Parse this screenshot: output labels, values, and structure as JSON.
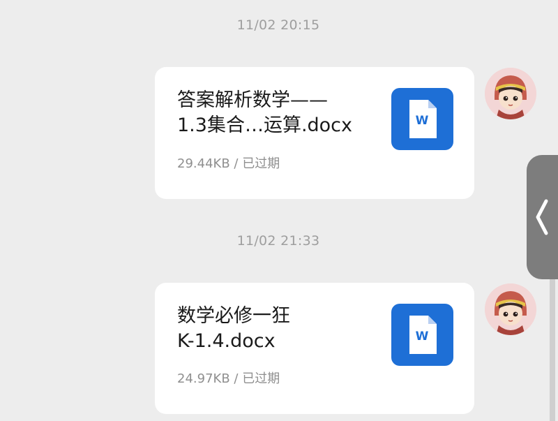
{
  "messages": [
    {
      "timestamp": "11/02 20:15",
      "file": {
        "name": "答案解析数学——\n1.3集合…运算.docx",
        "size": "29.44KB",
        "separator": " / ",
        "status": "已过期",
        "icon": "word-doc-icon",
        "icon_letter": "W"
      },
      "sender_avatar": "avatar-girl-icon"
    },
    {
      "timestamp": "11/02 21:33",
      "file": {
        "name": "数学必修一狂\nK-1.4.docx",
        "size": "24.97KB",
        "separator": " / ",
        "status": "已过期",
        "icon": "word-doc-icon",
        "icon_letter": "W"
      },
      "sender_avatar": "avatar-girl-icon"
    }
  ],
  "side_handle": {
    "icon": "chevron-left-icon"
  },
  "colors": {
    "background": "#ededed",
    "card": "#ffffff",
    "word_blue": "#1e6fd6",
    "timestamp_text": "#9e9e9e",
    "meta_text": "#8f8f8f",
    "handle": "#7d7d7d"
  }
}
